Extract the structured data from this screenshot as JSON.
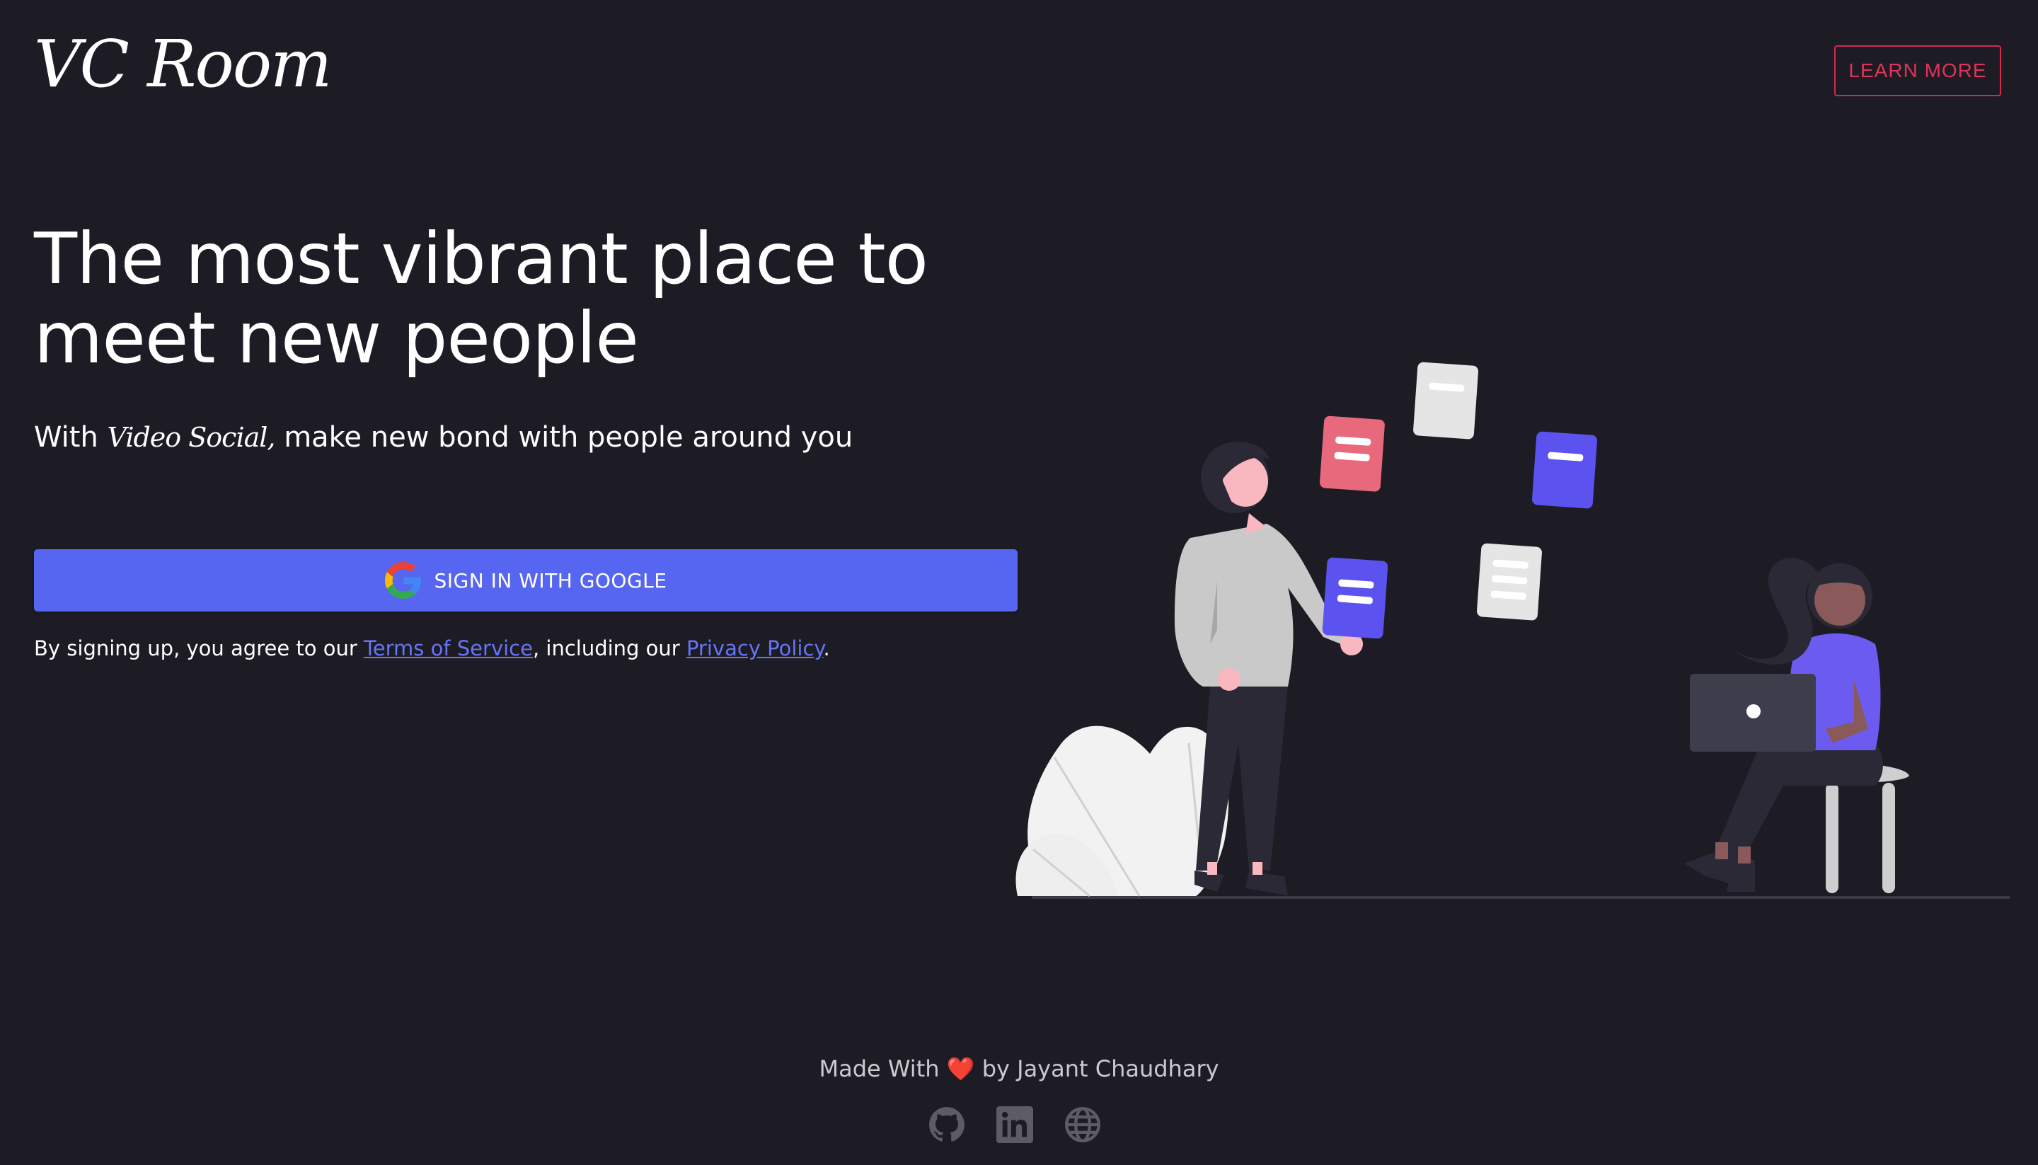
{
  "header": {
    "logo_text": "VC Room",
    "learn_more_label": "LEARN MORE"
  },
  "hero": {
    "headline": "The most vibrant place to meet new people",
    "subline_prefix": "With",
    "subline_brand": "Video Social,",
    "subline_suffix": "make new bond with people around you",
    "google_button_label": "SIGN IN WITH GOOGLE",
    "terms_prefix": "By signing up, you agree to our",
    "terms_link": "Terms of Service",
    "terms_middle": ", including our",
    "privacy_link": "Privacy Policy",
    "terms_end": "."
  },
  "footer": {
    "made_with": "Made With",
    "heart": "❤️",
    "by_author": "by Jayant Chaudhary",
    "social_icons": [
      "github-icon",
      "linkedin-icon",
      "globe-icon"
    ]
  },
  "colors": {
    "background": "#1d1c25",
    "primary": "#5666f0",
    "accent": "#e0335a",
    "link": "#6674f6"
  }
}
